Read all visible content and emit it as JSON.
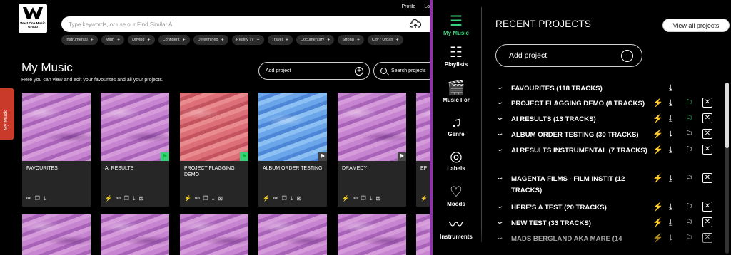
{
  "logo": {
    "text": "West One Music Group"
  },
  "topnav": [
    "Profile",
    "Log"
  ],
  "search": {
    "placeholder": "Type keywords, or use our Find Similar AI"
  },
  "chips": [
    "Instrumental",
    "Main",
    "Driving",
    "Confident",
    "Determined",
    "Reality Tv",
    "Travel",
    "Documentary",
    "Strong",
    "City / Urban"
  ],
  "main": {
    "title": "My Music",
    "subtitle": "Here you can view and edit your favourites and all your projects.",
    "add_project": "Add project",
    "search_projects": "Search projects",
    "side_tab": "My Music",
    "cards": [
      {
        "title": "FAVOURITES",
        "art": "pink",
        "flag": ""
      },
      {
        "title": "AI RESULTS",
        "art": "pink",
        "flag": "green"
      },
      {
        "title": "PROJECT FLAGGING DEMO",
        "art": "red",
        "flag": "green"
      },
      {
        "title": "ALBUM ORDER TESTING",
        "art": "blue",
        "flag": "dark"
      },
      {
        "title": "DRAMEDY",
        "art": "pink",
        "flag": "dark"
      },
      {
        "title": "EP",
        "art": "pink",
        "flag": "dark"
      }
    ]
  },
  "panel": {
    "nav": [
      {
        "label": "My Music",
        "icon": "list-icon",
        "active": true
      },
      {
        "label": "Playlists",
        "icon": "playlist-icon",
        "active": false
      },
      {
        "label": "Music For",
        "icon": "clapperboard-icon",
        "active": false
      },
      {
        "label": "Genre",
        "icon": "music-note-icon",
        "active": false
      },
      {
        "label": "Labels",
        "icon": "vinyl-icon",
        "active": false
      },
      {
        "label": "Moods",
        "icon": "heart-icon",
        "active": false
      },
      {
        "label": "Instruments",
        "icon": "instrument-icon",
        "active": false
      }
    ],
    "title": "RECENT PROJECTS",
    "view_all": "View all projects",
    "add_project": "Add project",
    "projects": [
      {
        "name": "FAVOURITES (118 TRACKS)",
        "bolt": false,
        "bolt_green": false,
        "flag": false,
        "flag_green": false,
        "close": false
      },
      {
        "name": "PROJECT FLAGGING DEMO (8 TRACKS)",
        "bolt": true,
        "bolt_green": true,
        "flag": true,
        "flag_green": true,
        "close": true
      },
      {
        "name": "AI RESULTS (13 TRACKS)",
        "bolt": true,
        "bolt_green": false,
        "flag": true,
        "flag_green": true,
        "close": true
      },
      {
        "name": "ALBUM ORDER TESTING (30 TRACKS)",
        "bolt": true,
        "bolt_green": false,
        "flag": true,
        "flag_green": false,
        "close": true
      },
      {
        "name": "AI RESULTS INSTRUMENTAL (7 TRACKS)",
        "bolt": true,
        "bolt_green": false,
        "flag": true,
        "flag_green": false,
        "close": true
      },
      {
        "name": "MAGENTA FILMS - FILM INSTIT (12 TRACKS)",
        "bolt": true,
        "bolt_green": false,
        "flag": true,
        "flag_green": false,
        "close": true
      },
      {
        "name": "HERE'S A TEST (20 TRACKS)",
        "bolt": true,
        "bolt_green": false,
        "flag": true,
        "flag_green": false,
        "close": true
      },
      {
        "name": "NEW TEST (33 TRACKS)",
        "bolt": true,
        "bolt_green": false,
        "flag": true,
        "flag_green": false,
        "close": true
      },
      {
        "name": "MADS BERGLAND AKA MARE (14",
        "bolt": true,
        "bolt_green": false,
        "flag": true,
        "flag_green": false,
        "close": true
      }
    ]
  },
  "colors": {
    "accent_purple": "#8b35a6",
    "green": "#3ccf7a",
    "tab_red": "#c93a2a"
  }
}
